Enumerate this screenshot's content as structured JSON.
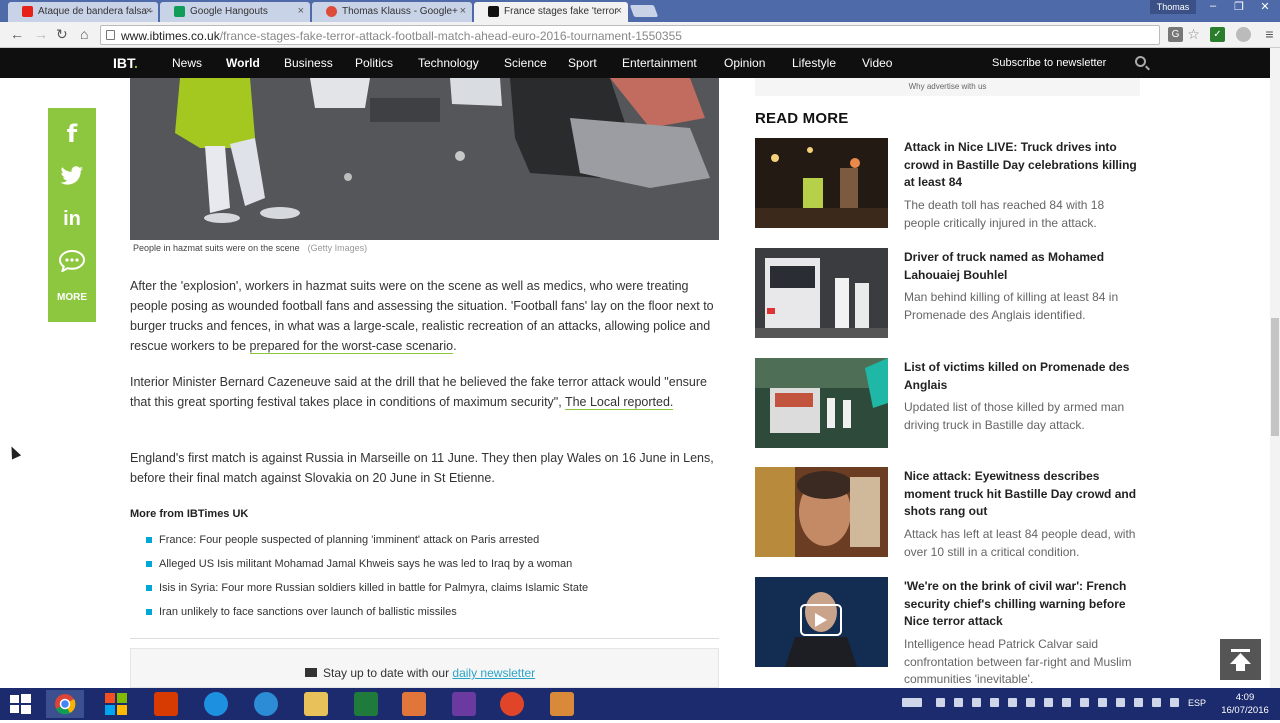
{
  "browser": {
    "tabs": [
      {
        "title": "Ataque de bandera falsa -",
        "icon": "youtube-icon",
        "color": "#e62117"
      },
      {
        "title": "Google Hangouts",
        "icon": "hangouts-icon",
        "color": "#0f9d58"
      },
      {
        "title": "Thomas Klauss - Google+",
        "icon": "google-plus-icon",
        "color": "#dd4b39"
      },
      {
        "title": "France stages fake 'terror",
        "icon": "ibt-icon",
        "color": "#111111"
      }
    ],
    "profile": "Thomas",
    "url_host": "www.ibtimes.co.uk",
    "url_path": "/france-stages-fake-terror-attack-football-match-ahead-euro-2016-tournament-1550355"
  },
  "site": {
    "logo": "IBT",
    "logo_dot": ".",
    "nav": [
      "News",
      "World",
      "Business",
      "Politics",
      "Technology",
      "Science",
      "Sport",
      "Entertainment",
      "Opinion",
      "Lifestyle",
      "Video"
    ],
    "current": "World",
    "subscribe": "Subscribe to newsletter",
    "accent": "#8dc63f"
  },
  "social": {
    "facebook": "f",
    "more": "MORE"
  },
  "article": {
    "caption": "People in hazmat suits were on the scene",
    "credit": "(Getty Images)",
    "p1": "After the 'explosion', workers in hazmat suits were on the scene as well as medics, who were treating people posing as wounded football fans and assessing the situation. 'Football fans' lay on the floor next to burger trucks and fences, in what was a large-scale, realistic recreation of an attacks, allowing police and rescue workers to be ",
    "p1_link": "prepared for the worst-case scenario",
    "p1_end": ".",
    "p2": "Interior Minister Bernard Cazeneuve said at the drill that he believed the fake terror attack would \"ensure that this great sporting festival takes place in conditions of maximum security\", ",
    "p2_link": "The Local reported.",
    "p3": "England's first match is against Russia in Marseille on 11 June. They then play Wales on 16 June in Lens, before their final match against Slovakia on 20 June in St Etienne.",
    "more_title": "More from IBTimes UK",
    "more_items": [
      "France: Four people suspected of planning 'imminent' attack on Paris arrested",
      "Alleged US Isis militant Mohamad Jamal Khweis says he was led to Iraq by a woman",
      "Isis in Syria: Four more Russian soldiers killed in battle for Palmyra, claims Islamic State",
      "Iran unlikely to face sanctions over launch of ballistic missiles"
    ],
    "newsletter_text": "Stay up to date with our ",
    "newsletter_link": "daily newsletter"
  },
  "sidebar": {
    "ad_note": "Why advertise with us",
    "read_more": "READ MORE",
    "items": [
      {
        "title": "Attack in Nice LIVE: Truck drives into crowd in Bastille Day celebrations killing at least 84",
        "desc": "The death toll has reached 84 with 18 people critically injured in the attack."
      },
      {
        "title": "Driver of truck named as Mohamed Lahouaiej Bouhlel",
        "desc": "Man behind killing of killing at least 84 in Promenade des Anglais identified."
      },
      {
        "title": "List of victims killed on Promenade des Anglais",
        "desc": "Updated list of those killed by armed man driving truck in Bastille day attack."
      },
      {
        "title": "Nice attack: Eyewitness describes moment truck hit Bastille Day crowd and shots rang out",
        "desc": "Attack has left at least 84 people dead, with over 10 still in a critical condition."
      },
      {
        "title": "'We're on the brink of civil war': French security chief's chilling warning before Nice terror attack",
        "desc": "Intelligence head Patrick Calvar said confrontation between far-right and Muslim communities 'inevitable'."
      }
    ]
  },
  "taskbar": {
    "lang": "ESP",
    "time": "4:09",
    "date": "16/07/2016"
  }
}
